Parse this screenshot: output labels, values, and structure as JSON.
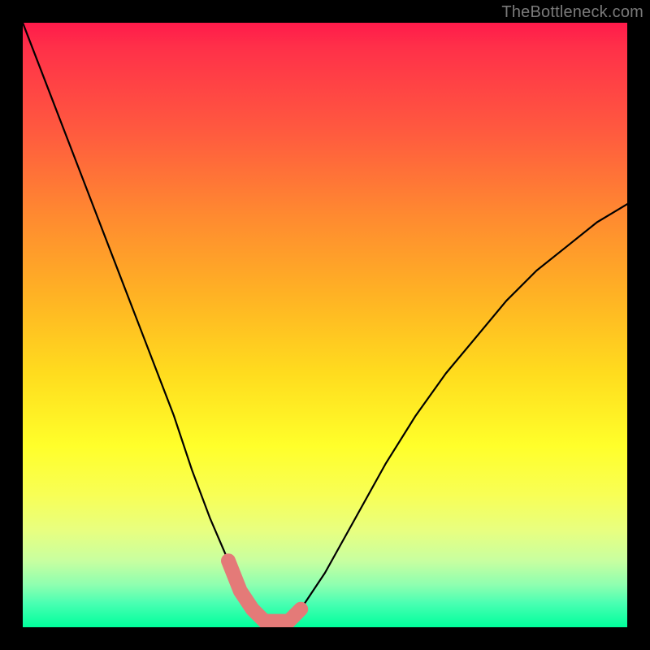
{
  "watermark": "TheBottleneck.com",
  "chart_data": {
    "type": "line",
    "title": "",
    "xlabel": "",
    "ylabel": "",
    "xlim": [
      0,
      100
    ],
    "ylim": [
      0,
      100
    ],
    "series": [
      {
        "name": "bottleneck-curve",
        "x": [
          0,
          5,
          10,
          15,
          20,
          25,
          28,
          31,
          34,
          36,
          38,
          40,
          42,
          44,
          46,
          50,
          55,
          60,
          65,
          70,
          75,
          80,
          85,
          90,
          95,
          100
        ],
        "values": [
          100,
          87,
          74,
          61,
          48,
          35,
          26,
          18,
          11,
          6,
          3,
          1,
          1,
          1,
          3,
          9,
          18,
          27,
          35,
          42,
          48,
          54,
          59,
          63,
          67,
          70
        ]
      }
    ],
    "annotations": [
      {
        "name": "highlight-range",
        "x_start": 34,
        "x_end": 46,
        "color": "#e47a78"
      }
    ],
    "gradient_meaning": "red=high bottleneck, green=balanced"
  }
}
